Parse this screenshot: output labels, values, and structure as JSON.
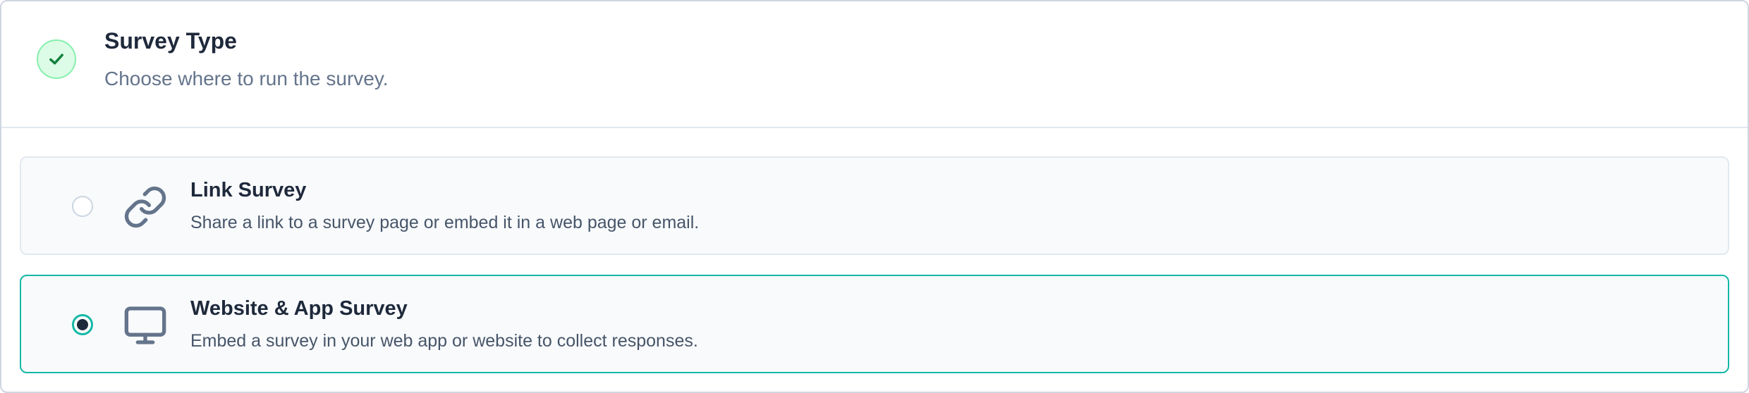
{
  "header": {
    "title": "Survey Type",
    "subtitle": "Choose where to run the survey.",
    "status_icon": "check-icon"
  },
  "options": [
    {
      "title": "Link Survey",
      "description": "Share a link to a survey page or embed it in a web page or email.",
      "icon": "link-icon",
      "selected": false
    },
    {
      "title": "Website & App Survey",
      "description": "Embed a survey in your web app or website to collect responses.",
      "icon": "monitor-icon",
      "selected": true
    }
  ],
  "colors": {
    "accent": "#14b8a6",
    "success": "#16a34a",
    "icon": "#64748b"
  }
}
